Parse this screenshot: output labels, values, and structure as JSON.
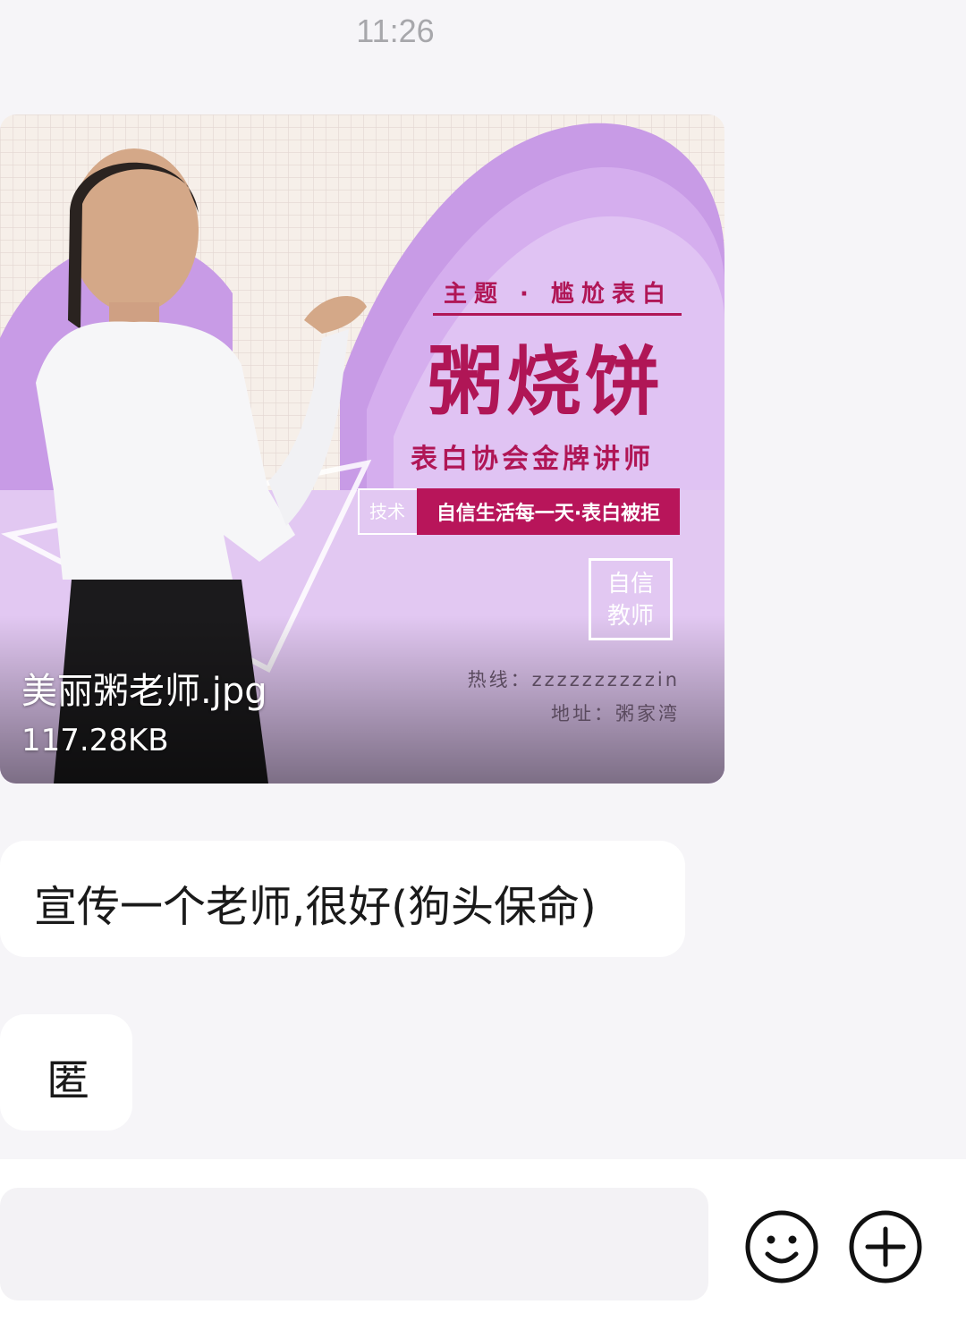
{
  "status": {
    "time": "11:26"
  },
  "attachment": {
    "file_name": "美丽粥老师.jpg",
    "file_size": "117.28KB",
    "poster": {
      "topic": "主题 · 尴尬表白",
      "name": "粥烧饼",
      "subtitle": "表白协会金牌讲师",
      "tag_label": "技术",
      "tag_text": "自信生活每一天·表白被拒",
      "badge_line1": "自信",
      "badge_line2": "教师",
      "hotline": "热线：zzzzzzzzzzin",
      "address": "地址：粥家湾"
    }
  },
  "messages": [
    {
      "text": "宣传一个老师,很好(狗头保命)"
    },
    {
      "text": "匿"
    }
  ],
  "composer": {
    "placeholder": "",
    "emoji_icon": "smiley-icon",
    "plus_icon": "plus-circle-icon"
  },
  "colors": {
    "accent": "#b01656",
    "poster_purple": "#cfa4ea",
    "bubble_bg": "#ffffff",
    "page_bg": "#f6f5f8"
  }
}
